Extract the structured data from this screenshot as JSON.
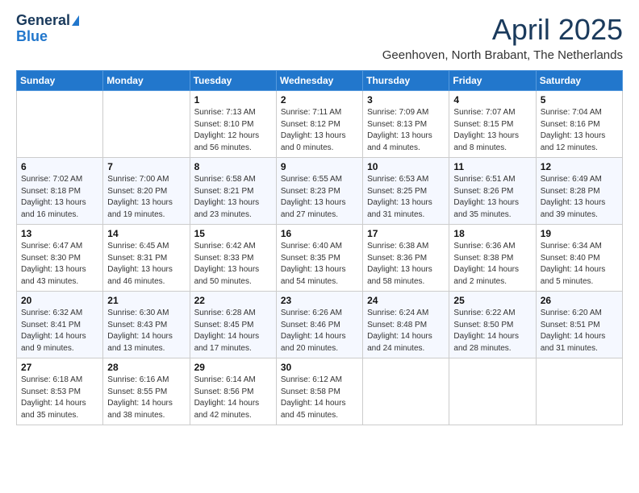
{
  "header": {
    "logo_general": "General",
    "logo_blue": "Blue",
    "title": "April 2025",
    "location": "Geenhoven, North Brabant, The Netherlands"
  },
  "weekdays": [
    "Sunday",
    "Monday",
    "Tuesday",
    "Wednesday",
    "Thursday",
    "Friday",
    "Saturday"
  ],
  "weeks": [
    [
      {
        "day": "",
        "detail": ""
      },
      {
        "day": "",
        "detail": ""
      },
      {
        "day": "1",
        "detail": "Sunrise: 7:13 AM\nSunset: 8:10 PM\nDaylight: 12 hours\nand 56 minutes."
      },
      {
        "day": "2",
        "detail": "Sunrise: 7:11 AM\nSunset: 8:12 PM\nDaylight: 13 hours\nand 0 minutes."
      },
      {
        "day": "3",
        "detail": "Sunrise: 7:09 AM\nSunset: 8:13 PM\nDaylight: 13 hours\nand 4 minutes."
      },
      {
        "day": "4",
        "detail": "Sunrise: 7:07 AM\nSunset: 8:15 PM\nDaylight: 13 hours\nand 8 minutes."
      },
      {
        "day": "5",
        "detail": "Sunrise: 7:04 AM\nSunset: 8:16 PM\nDaylight: 13 hours\nand 12 minutes."
      }
    ],
    [
      {
        "day": "6",
        "detail": "Sunrise: 7:02 AM\nSunset: 8:18 PM\nDaylight: 13 hours\nand 16 minutes."
      },
      {
        "day": "7",
        "detail": "Sunrise: 7:00 AM\nSunset: 8:20 PM\nDaylight: 13 hours\nand 19 minutes."
      },
      {
        "day": "8",
        "detail": "Sunrise: 6:58 AM\nSunset: 8:21 PM\nDaylight: 13 hours\nand 23 minutes."
      },
      {
        "day": "9",
        "detail": "Sunrise: 6:55 AM\nSunset: 8:23 PM\nDaylight: 13 hours\nand 27 minutes."
      },
      {
        "day": "10",
        "detail": "Sunrise: 6:53 AM\nSunset: 8:25 PM\nDaylight: 13 hours\nand 31 minutes."
      },
      {
        "day": "11",
        "detail": "Sunrise: 6:51 AM\nSunset: 8:26 PM\nDaylight: 13 hours\nand 35 minutes."
      },
      {
        "day": "12",
        "detail": "Sunrise: 6:49 AM\nSunset: 8:28 PM\nDaylight: 13 hours\nand 39 minutes."
      }
    ],
    [
      {
        "day": "13",
        "detail": "Sunrise: 6:47 AM\nSunset: 8:30 PM\nDaylight: 13 hours\nand 43 minutes."
      },
      {
        "day": "14",
        "detail": "Sunrise: 6:45 AM\nSunset: 8:31 PM\nDaylight: 13 hours\nand 46 minutes."
      },
      {
        "day": "15",
        "detail": "Sunrise: 6:42 AM\nSunset: 8:33 PM\nDaylight: 13 hours\nand 50 minutes."
      },
      {
        "day": "16",
        "detail": "Sunrise: 6:40 AM\nSunset: 8:35 PM\nDaylight: 13 hours\nand 54 minutes."
      },
      {
        "day": "17",
        "detail": "Sunrise: 6:38 AM\nSunset: 8:36 PM\nDaylight: 13 hours\nand 58 minutes."
      },
      {
        "day": "18",
        "detail": "Sunrise: 6:36 AM\nSunset: 8:38 PM\nDaylight: 14 hours\nand 2 minutes."
      },
      {
        "day": "19",
        "detail": "Sunrise: 6:34 AM\nSunset: 8:40 PM\nDaylight: 14 hours\nand 5 minutes."
      }
    ],
    [
      {
        "day": "20",
        "detail": "Sunrise: 6:32 AM\nSunset: 8:41 PM\nDaylight: 14 hours\nand 9 minutes."
      },
      {
        "day": "21",
        "detail": "Sunrise: 6:30 AM\nSunset: 8:43 PM\nDaylight: 14 hours\nand 13 minutes."
      },
      {
        "day": "22",
        "detail": "Sunrise: 6:28 AM\nSunset: 8:45 PM\nDaylight: 14 hours\nand 17 minutes."
      },
      {
        "day": "23",
        "detail": "Sunrise: 6:26 AM\nSunset: 8:46 PM\nDaylight: 14 hours\nand 20 minutes."
      },
      {
        "day": "24",
        "detail": "Sunrise: 6:24 AM\nSunset: 8:48 PM\nDaylight: 14 hours\nand 24 minutes."
      },
      {
        "day": "25",
        "detail": "Sunrise: 6:22 AM\nSunset: 8:50 PM\nDaylight: 14 hours\nand 28 minutes."
      },
      {
        "day": "26",
        "detail": "Sunrise: 6:20 AM\nSunset: 8:51 PM\nDaylight: 14 hours\nand 31 minutes."
      }
    ],
    [
      {
        "day": "27",
        "detail": "Sunrise: 6:18 AM\nSunset: 8:53 PM\nDaylight: 14 hours\nand 35 minutes."
      },
      {
        "day": "28",
        "detail": "Sunrise: 6:16 AM\nSunset: 8:55 PM\nDaylight: 14 hours\nand 38 minutes."
      },
      {
        "day": "29",
        "detail": "Sunrise: 6:14 AM\nSunset: 8:56 PM\nDaylight: 14 hours\nand 42 minutes."
      },
      {
        "day": "30",
        "detail": "Sunrise: 6:12 AM\nSunset: 8:58 PM\nDaylight: 14 hours\nand 45 minutes."
      },
      {
        "day": "",
        "detail": ""
      },
      {
        "day": "",
        "detail": ""
      },
      {
        "day": "",
        "detail": ""
      }
    ]
  ]
}
